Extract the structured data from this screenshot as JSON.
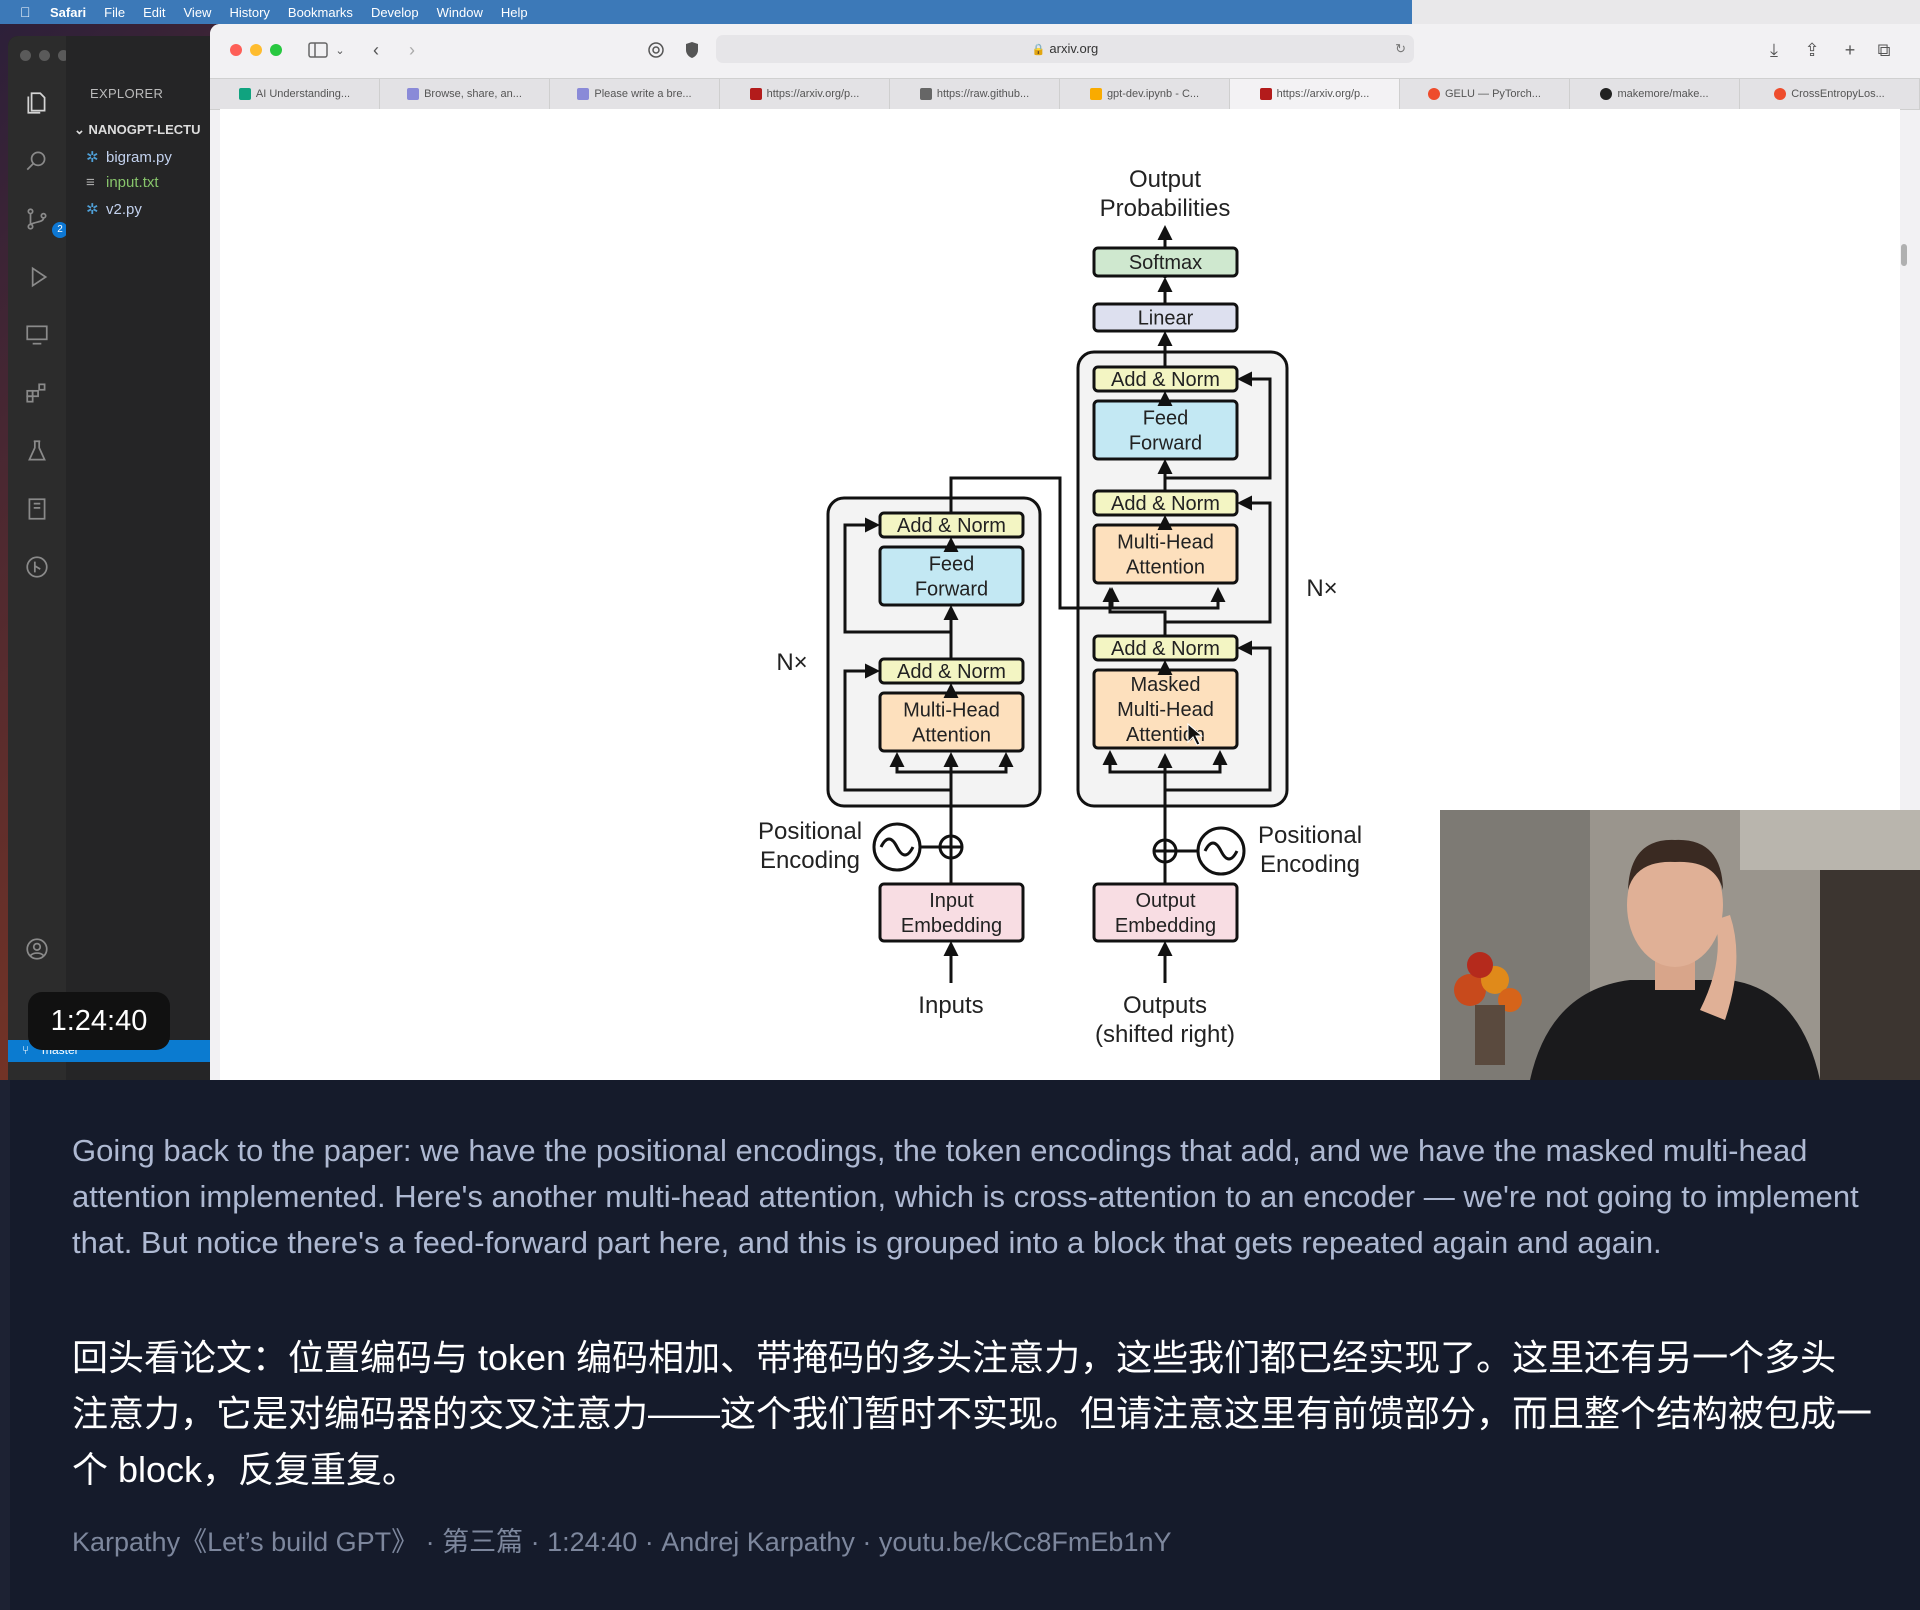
{
  "menubar": {
    "items": [
      "Safari",
      "File",
      "Edit",
      "View",
      "History",
      "Bookmarks",
      "Develop",
      "Window",
      "Help"
    ]
  },
  "vscode": {
    "explorer_title": "EXPLORER",
    "folder": "NANOGPT-LECTU",
    "files": [
      {
        "name": "bigram.py",
        "type": "py"
      },
      {
        "name": "input.txt",
        "type": "txt"
      },
      {
        "name": "v2.py",
        "type": "py"
      }
    ],
    "scm_badge": "2",
    "status_branch": "master"
  },
  "video_time": "1:24:40",
  "safari": {
    "url": "arxiv.org",
    "tabs": [
      {
        "label": "AI Understanding...",
        "color": "#10a37f"
      },
      {
        "label": "Browse, share, an...",
        "color": "#8a8ad8"
      },
      {
        "label": "Please write a bre...",
        "color": "#8a8ad8"
      },
      {
        "label": "https://arxiv.org/p...",
        "color": "#b31b1b"
      },
      {
        "label": "https://raw.github...",
        "color": "#666666"
      },
      {
        "label": "gpt-dev.ipynb - C...",
        "color": "#f9ab00"
      },
      {
        "label": "https://arxiv.org/p...",
        "color": "#b31b1b",
        "active": true
      },
      {
        "label": "GELU — PyTorch...",
        "color": "#ee4c2c"
      },
      {
        "label": "makemore/make...",
        "color": "#222222"
      },
      {
        "label": "CrossEntropyLos...",
        "color": "#ee4c2c"
      }
    ]
  },
  "diagram": {
    "output_probabilities": [
      "Output",
      "Probabilities"
    ],
    "softmax": "Softmax",
    "linear": "Linear",
    "add_norm": "Add & Norm",
    "feed_forward": [
      "Feed",
      "Forward"
    ],
    "multi_head_attention": [
      "Multi-Head",
      "Attention"
    ],
    "masked_attention": [
      "Masked",
      "Multi-Head",
      "Attention"
    ],
    "nx": "N×",
    "positional_encoding": [
      "Positional",
      "Encoding"
    ],
    "input_embedding": [
      "Input",
      "Embedding"
    ],
    "output_embedding": [
      "Output",
      "Embedding"
    ],
    "inputs": "Inputs",
    "outputs": [
      "Outputs",
      "(shifted right)"
    ],
    "colors": {
      "add_norm": "#f3f5c3",
      "feed_forward": "#c3e8f3",
      "attention": "#fde0bd",
      "embedding": "#f8dde3",
      "softmax": "#cfe8cf",
      "linear": "#dde0ef",
      "block": "#f3f3f3"
    }
  },
  "captions": {
    "english": "Going back to the paper: we have the positional encodings, the token encodings that add, and we have the masked multi-head attention implemented. Here's another multi-head attention, which is cross-attention to an encoder — we're not going to implement that. But notice there's a feed-forward part here, and this is grouped into a block that gets repeated again and again.",
    "chinese": "回头看论文：位置编码与 token 编码相加、带掩码的多头注意力，这些我们都已经实现了。这里还有另一个多头注意力，它是对编码器的交叉注意力——这个我们暂时不实现。但请注意这里有前馈部分，而且整个结构被包成一个 block，反复重复。",
    "source": "Karpathy《Let’s build GPT》 · 第三篇 · 1:24:40 · Andrej Karpathy · youtu.be/kCc8FmEb1nY"
  }
}
